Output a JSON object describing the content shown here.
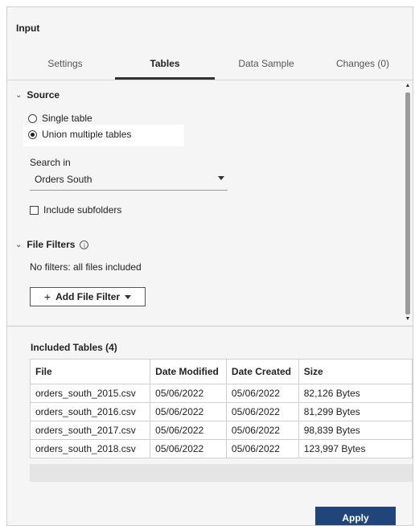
{
  "panel": {
    "title": "Input"
  },
  "tabs": [
    {
      "label": "Settings",
      "active": false
    },
    {
      "label": "Tables",
      "active": true
    },
    {
      "label": "Data Sample",
      "active": false
    },
    {
      "label": "Changes (0)",
      "active": false
    }
  ],
  "source": {
    "heading": "Source",
    "options": [
      {
        "label": "Single table",
        "checked": false
      },
      {
        "label": "Union multiple tables",
        "checked": true
      }
    ],
    "search_label": "Search in",
    "search_value": "Orders South",
    "include_subfolders_label": "Include subfolders",
    "include_subfolders_checked": false
  },
  "file_filters": {
    "heading": "File Filters",
    "info_icon": "info-icon",
    "status": "No filters: all files included",
    "add_button_label": "Add File Filter"
  },
  "included_tables": {
    "title": "Included Tables (4)",
    "columns": [
      "File",
      "Date Modified",
      "Date Created",
      "Size"
    ],
    "rows": [
      [
        "orders_south_2015.csv",
        "05/06/2022",
        "05/06/2022",
        "82,126 Bytes"
      ],
      [
        "orders_south_2016.csv",
        "05/06/2022",
        "05/06/2022",
        "81,299 Bytes"
      ],
      [
        "orders_south_2017.csv",
        "05/06/2022",
        "05/06/2022",
        "98,839 Bytes"
      ],
      [
        "orders_south_2018.csv",
        "05/06/2022",
        "05/06/2022",
        "123,997 Bytes"
      ]
    ]
  },
  "footer": {
    "apply_label": "Apply"
  },
  "colors": {
    "apply_button": "#1f457a",
    "panel_background": "#f5f5f5"
  }
}
